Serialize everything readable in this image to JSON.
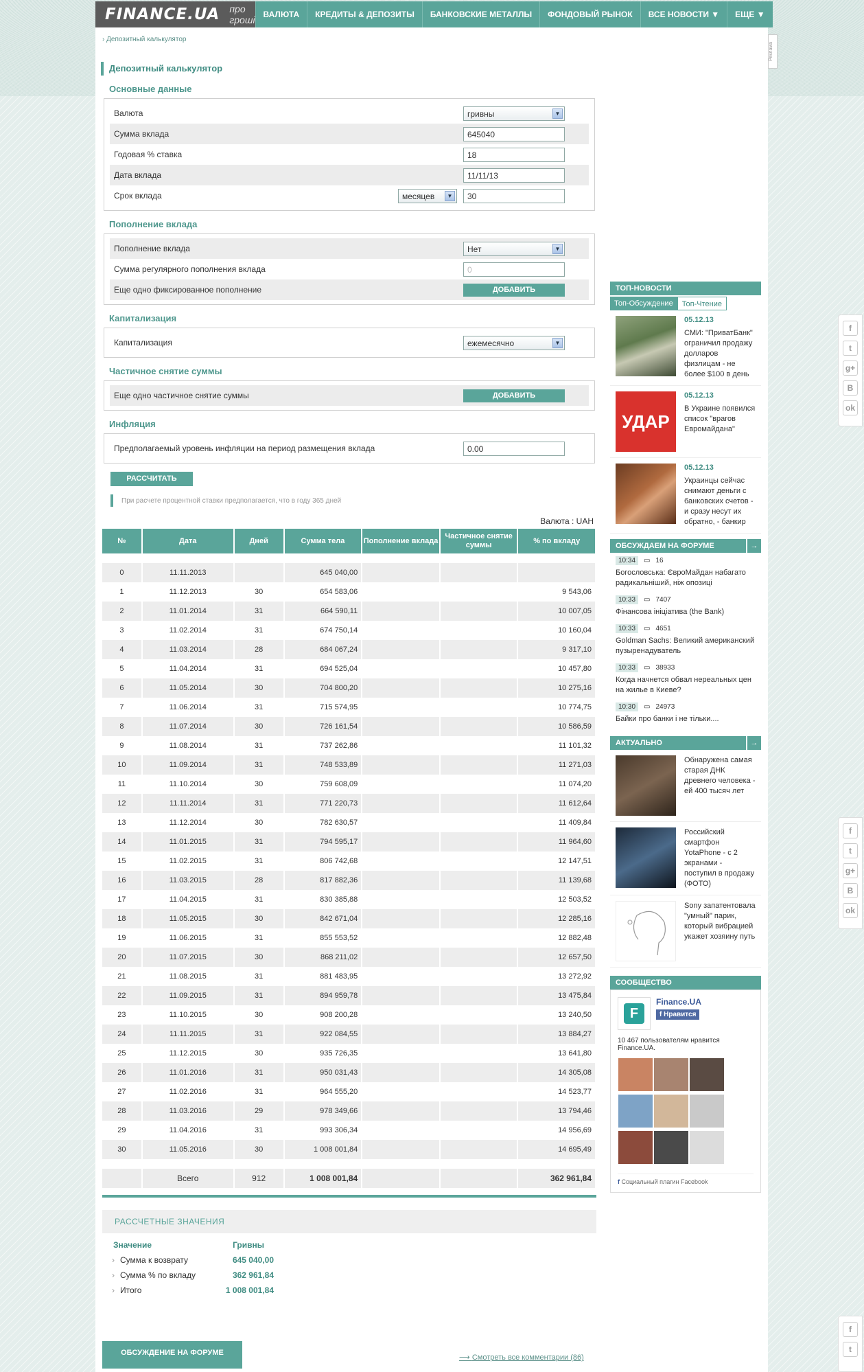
{
  "logo": {
    "brand": "FINANCE.UA",
    "tagline": "про гроші"
  },
  "nav": [
    "ВАЛЮТА",
    "КРЕДИТЫ & ДЕПОЗИТЫ",
    "БАНКОВСКИЕ МЕТАЛЛЫ",
    "ФОНДОВЫЙ РЫНОК",
    "ВСЕ НОВОСТИ ▼",
    "ЕЩЕ ▼"
  ],
  "breadcrumb": "Депозитный калькулятор",
  "ad_label": "Реклама",
  "title": "Депозитный калькулятор",
  "basic": {
    "header": "Основные данные",
    "currency_label": "Валюта",
    "currency_value": "гривны",
    "sum_label": "Сумма вклада",
    "sum_value": "645040",
    "rate_label": "Годовая % ставка",
    "rate_value": "18",
    "date_label": "Дата вклада",
    "date_value": "11/11/13",
    "term_label": "Срок вклада",
    "term_unit": "месяцев",
    "term_value": "30"
  },
  "refill": {
    "header": "Пополнение вклада",
    "refill_label": "Пополнение вклада",
    "refill_value": "Нет",
    "regular_label": "Сумма регулярного пополнения вклада",
    "regular_placeholder": "0",
    "fixed_label": "Еще одно фиксированное пополнение",
    "add_btn": "ДОБАВИТЬ"
  },
  "cap": {
    "header": "Капитализация",
    "label": "Капитализация",
    "value": "ежемесячно"
  },
  "withdraw": {
    "header": "Частичное снятие суммы",
    "label": "Еще одно частичное снятие суммы",
    "add_btn": "ДОБАВИТЬ"
  },
  "infl": {
    "header": "Инфляция",
    "label": "Предполагаемый уровень инфляции на период размещения вклада",
    "value": "0.00"
  },
  "calc_btn": "РАССЧИТАТЬ",
  "note": "При расчете процентной ставки предполагается, что в году 365 дней",
  "currency_line": "Валюта : UAH",
  "table": {
    "headers": [
      "№",
      "Дата",
      "Дней",
      "Сумма тела",
      "Пополнение вклада",
      "Частичное снятие суммы",
      "% по вкладу"
    ],
    "rows": [
      [
        "0",
        "11.11.2013",
        "",
        "645 040,00",
        "",
        "",
        ""
      ],
      [
        "1",
        "11.12.2013",
        "30",
        "654 583,06",
        "",
        "",
        "9 543,06"
      ],
      [
        "2",
        "11.01.2014",
        "31",
        "664 590,11",
        "",
        "",
        "10 007,05"
      ],
      [
        "3",
        "11.02.2014",
        "31",
        "674 750,14",
        "",
        "",
        "10 160,04"
      ],
      [
        "4",
        "11.03.2014",
        "28",
        "684 067,24",
        "",
        "",
        "9 317,10"
      ],
      [
        "5",
        "11.04.2014",
        "31",
        "694 525,04",
        "",
        "",
        "10 457,80"
      ],
      [
        "6",
        "11.05.2014",
        "30",
        "704 800,20",
        "",
        "",
        "10 275,16"
      ],
      [
        "7",
        "11.06.2014",
        "31",
        "715 574,95",
        "",
        "",
        "10 774,75"
      ],
      [
        "8",
        "11.07.2014",
        "30",
        "726 161,54",
        "",
        "",
        "10 586,59"
      ],
      [
        "9",
        "11.08.2014",
        "31",
        "737 262,86",
        "",
        "",
        "11 101,32"
      ],
      [
        "10",
        "11.09.2014",
        "31",
        "748 533,89",
        "",
        "",
        "11 271,03"
      ],
      [
        "11",
        "11.10.2014",
        "30",
        "759 608,09",
        "",
        "",
        "11 074,20"
      ],
      [
        "12",
        "11.11.2014",
        "31",
        "771 220,73",
        "",
        "",
        "11 612,64"
      ],
      [
        "13",
        "11.12.2014",
        "30",
        "782 630,57",
        "",
        "",
        "11 409,84"
      ],
      [
        "14",
        "11.01.2015",
        "31",
        "794 595,17",
        "",
        "",
        "11 964,60"
      ],
      [
        "15",
        "11.02.2015",
        "31",
        "806 742,68",
        "",
        "",
        "12 147,51"
      ],
      [
        "16",
        "11.03.2015",
        "28",
        "817 882,36",
        "",
        "",
        "11 139,68"
      ],
      [
        "17",
        "11.04.2015",
        "31",
        "830 385,88",
        "",
        "",
        "12 503,52"
      ],
      [
        "18",
        "11.05.2015",
        "30",
        "842 671,04",
        "",
        "",
        "12 285,16"
      ],
      [
        "19",
        "11.06.2015",
        "31",
        "855 553,52",
        "",
        "",
        "12 882,48"
      ],
      [
        "20",
        "11.07.2015",
        "30",
        "868 211,02",
        "",
        "",
        "12 657,50"
      ],
      [
        "21",
        "11.08.2015",
        "31",
        "881 483,95",
        "",
        "",
        "13 272,92"
      ],
      [
        "22",
        "11.09.2015",
        "31",
        "894 959,78",
        "",
        "",
        "13 475,84"
      ],
      [
        "23",
        "11.10.2015",
        "30",
        "908 200,28",
        "",
        "",
        "13 240,50"
      ],
      [
        "24",
        "11.11.2015",
        "31",
        "922 084,55",
        "",
        "",
        "13 884,27"
      ],
      [
        "25",
        "11.12.2015",
        "30",
        "935 726,35",
        "",
        "",
        "13 641,80"
      ],
      [
        "26",
        "11.01.2016",
        "31",
        "950 031,43",
        "",
        "",
        "14 305,08"
      ],
      [
        "27",
        "11.02.2016",
        "31",
        "964 555,20",
        "",
        "",
        "14 523,77"
      ],
      [
        "28",
        "11.03.2016",
        "29",
        "978 349,66",
        "",
        "",
        "13 794,46"
      ],
      [
        "29",
        "11.04.2016",
        "31",
        "993 306,34",
        "",
        "",
        "14 956,69"
      ],
      [
        "30",
        "11.05.2016",
        "30",
        "1 008 001,84",
        "",
        "",
        "14 695,49"
      ]
    ],
    "total": [
      "",
      "Всего",
      "912",
      "1 008 001,84",
      "",
      "",
      "362 961,84"
    ]
  },
  "results": {
    "header": "РАССЧЕТНЫЕ ЗНАЧЕНИЯ",
    "col1": "Значение",
    "col2": "Гривны",
    "rows": [
      [
        "Сумма к возврату",
        "645 040,00"
      ],
      [
        "Сумма % по вкладу",
        "362 961,84"
      ],
      [
        "Итого",
        "1 008 001,84"
      ]
    ]
  },
  "forum_btn": "ОБСУЖДЕНИЕ НА ФОРУМЕ",
  "all_comments": "Смотреть все комментарии (86)",
  "side": {
    "top_header": "ТОП-НОВОСТИ",
    "tab1": "Топ-Обсуждение",
    "tab2": "Топ-Чтение",
    "news": [
      {
        "date": "05.12.13",
        "text": "СМИ: \"ПриватБанк\" ограничил продажу долларов физлицам - не более $100 в день"
      },
      {
        "date": "05.12.13",
        "text": "В Украине появился список \"врагов Евромайдана\""
      },
      {
        "date": "05.12.13",
        "text": "Украинцы сейчас снимают деньги с банковских счетов - и сразу несут их обратно, - банкир"
      }
    ],
    "udar": "УДАР",
    "forum_header": "ОБСУЖДАЕМ НА ФОРУМЕ",
    "forum": [
      {
        "time": "10:34",
        "count": "16",
        "title": "Богословська: ЄвроМайдан набагато радикальніший, ніж опозиці"
      },
      {
        "time": "10:33",
        "count": "7407",
        "title": "Фінансова ініціатива (the Bank)"
      },
      {
        "time": "10:33",
        "count": "4651",
        "title": "Goldman Sachs: Великий американский пузыренадуватель"
      },
      {
        "time": "10:33",
        "count": "38933",
        "title": "Когда начнется обвал нереальных цен на жилье в Киеве?"
      },
      {
        "time": "10:30",
        "count": "24973",
        "title": "Байки про банки і не тільки...."
      }
    ],
    "actual_header": "АКТУАЛЬНО",
    "actual": [
      "Обнаружена самая старая ДНК древнего человека - ей 400 тысяч лет",
      "Российский смартфон YotaPhone - с 2 экранами - поступил в продажу (ФОТО)",
      "Sony запатентовала \"умный\" парик, который вибрацией укажет хозяину путь"
    ],
    "comm_header": "СООБЩЕСТВО",
    "comm_name": "Finance.UA",
    "comm_like": "Нравится",
    "comm_count": "10 467 пользователям нравится Finance.UA.",
    "comm_plugin": "Социальный плагин Facebook"
  },
  "colors": {
    "accent": "#5aa59a",
    "dark": "#5b5b5b"
  }
}
